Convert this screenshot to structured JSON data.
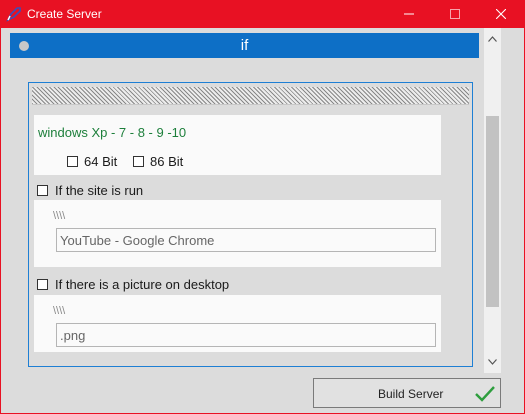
{
  "window": {
    "title": "Create Server",
    "icon": "rocket-icon",
    "frame_color": "#e81123"
  },
  "header": {
    "title": "if",
    "color": "#0d6fc6"
  },
  "os_section": {
    "title": "windows Xp - 7 - 8 - 9 -10",
    "options": [
      {
        "label": "64 Bit",
        "checked": false
      },
      {
        "label": "86 Bit",
        "checked": false
      }
    ]
  },
  "site_option": {
    "label": "If the site is run",
    "checked": false,
    "prefix": "\\\\\\\\",
    "value": "YouTube - Google Chrome"
  },
  "picture_option": {
    "label": "If there is a picture on  desktop",
    "checked": false,
    "prefix": "\\\\\\\\",
    "value": ".png"
  },
  "build_button": {
    "label": "Build Server",
    "icon": "check-icon",
    "icon_color": "#2e9e3e"
  }
}
